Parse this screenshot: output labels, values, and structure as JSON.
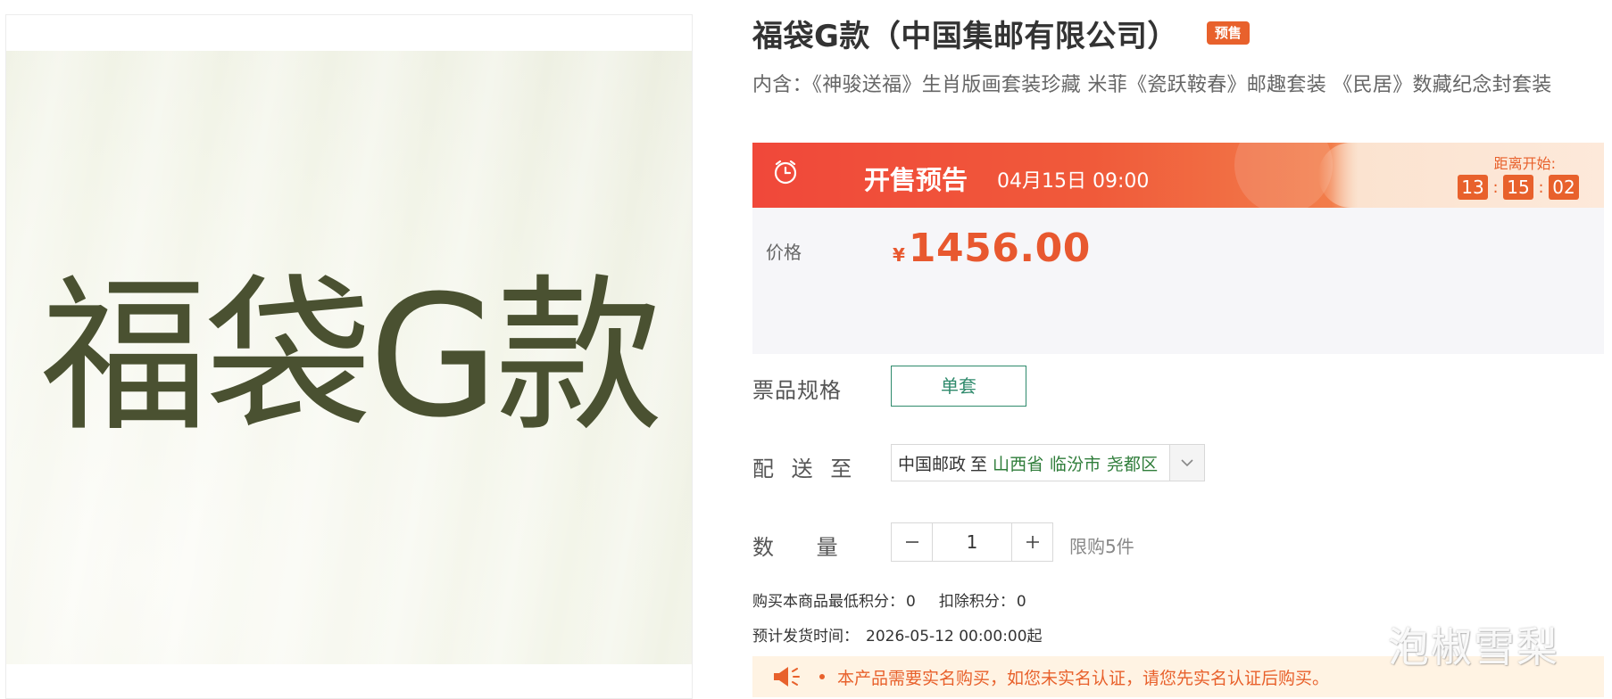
{
  "product_image": {
    "text": "福袋G款"
  },
  "product": {
    "title": "福袋G款（中国集邮有限公司）",
    "badge": "预售",
    "contents": "内含：《神骏送福》生肖版画套装珍藏 米菲《瓷跃鞍春》邮趣套装 《民居》数藏纪念封套装"
  },
  "presale_banner": {
    "icon": "alarm-clock-icon",
    "label": "开售预告",
    "start_time": "04月15日 09:00",
    "countdown_label": "距离开始:",
    "countdown": {
      "hours": "13",
      "minutes": "15",
      "seconds": "02",
      "separator": ":"
    }
  },
  "price": {
    "label": "价格",
    "currency": "¥",
    "value": "1456.00"
  },
  "spec": {
    "label": "票品规格",
    "options": [
      "单套"
    ],
    "selected": "单套"
  },
  "shipping": {
    "label": "配 送 至",
    "carrier": "中国邮政",
    "to": "至",
    "region": "山西省 临汾市 尧都区"
  },
  "quantity": {
    "label": "数  量",
    "value": "1",
    "limit": "限购5件"
  },
  "points": {
    "min_label": "购买本商品最低积分：",
    "min_value": "0",
    "deduct_label": "扣除积分：",
    "deduct_value": "0"
  },
  "ship_date": {
    "label": "预计发货时间：",
    "value": "2026-05-12 00:00:00起"
  },
  "notice": {
    "icon": "megaphone-icon",
    "text": "本产品需要实名购买，如您未实名认证，请您先实名认证后购买。"
  },
  "watermark": "泡椒雪梨",
  "colors": {
    "accent": "#e8612c",
    "price": "#e8582f",
    "spec_border": "#2f8a6c",
    "region_text": "#2f7d3a",
    "image_text": "#4a5131"
  }
}
